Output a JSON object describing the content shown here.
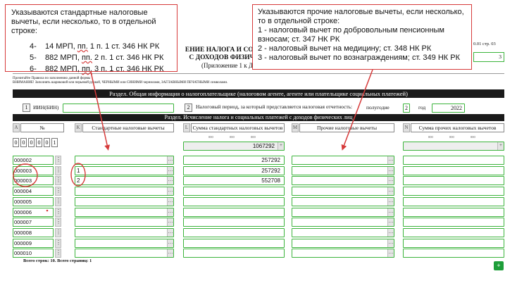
{
  "header": {
    "title_line1": "ЕНИЕ НАЛОГА И СОЦ",
    "title_line2": "С ДОХОДОВ ФИЗИЧ",
    "subtitle": "(Приложение 1 к Д",
    "form_code": "0.01  стр.  03",
    "page_value": "3",
    "note_line1": "Прочитайте Правила по заполнению данной формы",
    "note_line2": "ВНИМАНИЕ! Заполнять шариковой или перьевой ручкой, ЧЕРНЫМИ или СИНИМИ чернилами, ЗАГЛАВНЫМИ ПЕЧАТНЫМИ символами."
  },
  "section_general": "Раздел. Общая информация о налогоплательщике (налоговом агенте, агенте или плательщике социальных платежей)",
  "general": {
    "field1_number": "1",
    "iin_label": "ИИН(БИН)",
    "field2_number": "2",
    "period_label": "Налоговый период, за который представляется налоговая отчетность:",
    "halfyear_label": "полугодие",
    "halfyear_value": "2",
    "year_label": "год",
    "year_value": "2022"
  },
  "section_calc": "Раздел. Исчисление налога и социальных платежей с доходов физических лиц",
  "columns": [
    {
      "letter": "A",
      "label": "№"
    },
    {
      "letter": "K",
      "label": "Стандартные налоговые вычеты"
    },
    {
      "letter": "L",
      "label": "Сумма стандартных налоговых вычетов"
    },
    {
      "letter": "M",
      "label": "Прочие налоговые вычеты"
    },
    {
      "letter": "N",
      "label": "Сумма прочих налоговых вычетов"
    }
  ],
  "count_digits": [
    "0",
    "0",
    "0",
    "0",
    "0",
    "1"
  ],
  "mini_digits": [
    "000",
    "000",
    "000"
  ],
  "total_standard": "1067292",
  "rows": [
    {
      "num": "000002",
      "std_code": "",
      "std_sum": "257292"
    },
    {
      "num": "000003",
      "std_code": "1",
      "std_sum": "257292"
    },
    {
      "num": "000003",
      "std_code": "2",
      "std_sum": "552708"
    },
    {
      "num": "000004",
      "std_code": "",
      "std_sum": ""
    },
    {
      "num": "000005",
      "std_code": "",
      "std_sum": ""
    },
    {
      "num": "000006",
      "std_code": "",
      "std_sum": ""
    },
    {
      "num": "000007",
      "std_code": "",
      "std_sum": ""
    },
    {
      "num": "000008",
      "std_code": "",
      "std_sum": ""
    },
    {
      "num": "000009",
      "std_code": "",
      "std_sum": ""
    },
    {
      "num": "000010",
      "std_code": "",
      "std_sum": ""
    }
  ],
  "footer": {
    "totals_text": "Всего строк: 10. Всего страниц: 1",
    "add_label": "+"
  },
  "callout_left": {
    "intro": "Указываются стандартные налоговые вычеты, если несколько, то в отдельной строке:",
    "items": [
      {
        "prefix": "4-",
        "text_a": "14 МРП,",
        "pp": "пп.",
        "text_b": "1 п. 1 ст. 346 НК РК"
      },
      {
        "prefix": "5-",
        "text_a": "882 МРП,",
        "pp": "пп.",
        "text_b": "2 п. 1 ст. 346 НК РК"
      },
      {
        "prefix": "6-",
        "text_a": "882 МРП,",
        "pp": "пп.",
        "text_b": "3 п. 1 ст. 346 НК РК"
      }
    ]
  },
  "callout_right": {
    "intro": "Указываются прочие налоговые вычеты, если несколько, то в отдельной строке:",
    "items": [
      "1 - налоговый вычет по добровольным пенсионным взносам; ст. 347 НК РК",
      "2 - налоговый вычет на медицину; ст. 348 НК РК",
      "3 - налоговый вычет по вознаграждениям; ст. 349 НК РК"
    ]
  },
  "colors": {
    "field_border": "#3cb43c",
    "callout_border": "#d63a3a",
    "section_bar": "#1a1a1a",
    "add_button": "#1e9e3a"
  }
}
